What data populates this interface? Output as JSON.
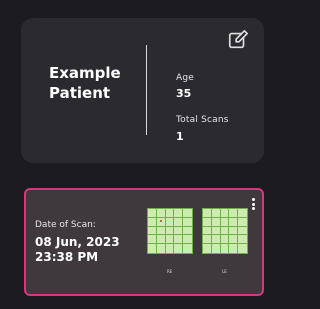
{
  "patient": {
    "name": "Example Patient",
    "age_label": "Age",
    "age_value": "35",
    "total_scans_label": "Total Scans",
    "total_scans_value": "1",
    "edit_icon": "edit-icon"
  },
  "scan": {
    "date_label": "Date of Scan:",
    "date_line1": "08 Jun, 2023",
    "date_line2": "23:38 PM",
    "left_caption": "RE",
    "right_caption": "LE",
    "menu_icon": "more-vertical-icon",
    "accent_color": "#d8357c",
    "grid_color": "#cdeab0"
  }
}
